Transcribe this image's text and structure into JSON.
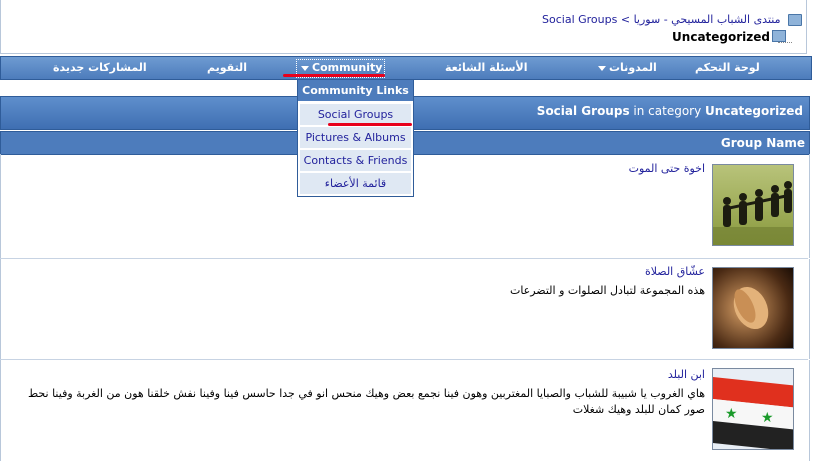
{
  "breadcrumb": {
    "forum": "منتدى الشباب المسيحي - سوريا",
    "separator": ">",
    "current": "Social Groups",
    "category": "Uncategorized"
  },
  "navbar": {
    "items": [
      "لوحة التحكم",
      "المدونات",
      "الأسئلة الشائعة",
      "Community",
      "التقويم",
      "المشاركات جديدة"
    ]
  },
  "community_menu": {
    "header": "Community Links",
    "items": [
      "Social Groups",
      "Pictures & Albums",
      "Contacts & Friends",
      "قائمة الأعضاء"
    ]
  },
  "category_bar": {
    "title": "Social Groups",
    "middle": "in category",
    "category": "Uncategorized"
  },
  "columns": {
    "group_name": "Group Name"
  },
  "groups": [
    {
      "name": "اخوة حتى الموت",
      "description": ""
    },
    {
      "name": "عشّاق الصلاة",
      "description": "هذه المجموعة لتبادل الصلوات و التضرعات"
    },
    {
      "name": "ابن البلد",
      "description": "هاي الغروب يا شبيبة للشباب والصبايا المغتربين وهون فينا نجمع بعض وهيك منحس انو في جدا حاسس فينا وفينا نفش خلقنا هون من الغربة وفينا نحط صور كمان للبلد وهيك شغلات"
    }
  ],
  "colors": {
    "nav_blue": "#4d7cbc",
    "link_blue": "#22229c",
    "highlight_red": "#e8001c",
    "menu_item_bg": "#dfe8f3"
  }
}
